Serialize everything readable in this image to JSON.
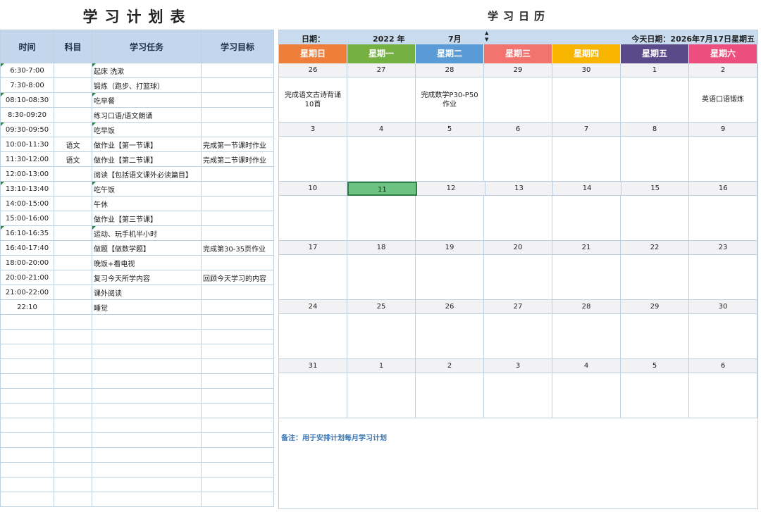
{
  "plan": {
    "title": "学习计划表",
    "headers": [
      "时间",
      "科目",
      "学习任务",
      "学习目标"
    ],
    "rows": [
      [
        "6:30-7:00",
        "",
        "起床 洗漱",
        ""
      ],
      [
        "7:30-8:00",
        "",
        "锻炼（跑步、打篮球）",
        ""
      ],
      [
        "08:10-08:30",
        "",
        "吃早餐",
        ""
      ],
      [
        "8:30-09:20",
        "",
        "练习口语/语文朗诵",
        ""
      ],
      [
        "09:30-09:50",
        "",
        "吃早饭",
        ""
      ],
      [
        "10:00-11:30",
        "语文",
        "做作业【第一节课】",
        "完成第一节课时作业"
      ],
      [
        "11:30-12:00",
        "语文",
        "做作业【第二节课】",
        "完成第二节课时作业"
      ],
      [
        "12:00-13:00",
        "",
        "阅读【包括语文课外必读篇目】",
        ""
      ],
      [
        "13:10-13:40",
        "",
        "吃午饭",
        ""
      ],
      [
        "14:00-15:00",
        "",
        "午休",
        ""
      ],
      [
        "15:00-16:00",
        "",
        "做作业【第三节课】",
        ""
      ],
      [
        "16:10-16:35",
        "",
        " 运动、玩手机半小时",
        ""
      ],
      [
        "16:40-17:40",
        "",
        "做题【做数学题】",
        "完成第30-35页作业"
      ],
      [
        "18:00-20:00",
        "",
        "晚饭+看电视",
        ""
      ],
      [
        "20:00-21:00",
        "",
        "复习今天所学内容",
        "回顾今天学习的内容"
      ],
      [
        "21:00-22:00",
        "",
        "课外阅读",
        ""
      ],
      [
        "22:10",
        "",
        "睡觉",
        ""
      ],
      [
        "",
        "",
        "",
        ""
      ],
      [
        "",
        "",
        "",
        ""
      ],
      [
        "",
        "",
        "",
        ""
      ],
      [
        "",
        "",
        "",
        ""
      ],
      [
        "",
        "",
        "",
        ""
      ],
      [
        "",
        "",
        "",
        ""
      ],
      [
        "",
        "",
        "",
        ""
      ],
      [
        "",
        "",
        "",
        ""
      ],
      [
        "",
        "",
        "",
        ""
      ],
      [
        "",
        "",
        "",
        ""
      ],
      [
        "",
        "",
        "",
        ""
      ],
      [
        "",
        "",
        "",
        ""
      ],
      [
        "",
        "",
        "",
        ""
      ]
    ],
    "marked_rows": [
      0,
      2,
      4,
      8,
      11
    ]
  },
  "calendar": {
    "title": "学习日历",
    "date_label": "日期：",
    "year": "2022 年",
    "month": "7月",
    "today_label": "今天日期：2026年7月17日星期五",
    "weekdays": [
      {
        "label": "星期日",
        "color": "#ee7f3a"
      },
      {
        "label": "星期一",
        "color": "#75b043"
      },
      {
        "label": "星期二",
        "color": "#5b9bd5"
      },
      {
        "label": "星期三",
        "color": "#f3736f"
      },
      {
        "label": "星期四",
        "color": "#f7b500"
      },
      {
        "label": "星期五",
        "color": "#5a4a8a"
      },
      {
        "label": "星期六",
        "color": "#ec4f7e"
      }
    ],
    "weeks": [
      {
        "days": [
          "26",
          "27",
          "28",
          "29",
          "30",
          "1",
          "2"
        ],
        "notes": [
          "完成语文古诗背诵10首",
          "",
          "完成数学P30-P50作业",
          "",
          "",
          "",
          "英语口语锻炼"
        ]
      },
      {
        "days": [
          "3",
          "4",
          "5",
          "6",
          "7",
          "8",
          "9"
        ],
        "notes": [
          "",
          "",
          "",
          "",
          "",
          "",
          ""
        ]
      },
      {
        "days": [
          "10",
          "11",
          "12",
          "13",
          "14",
          "15",
          "16"
        ],
        "notes": [
          "",
          "",
          "",
          "",
          "",
          "",
          ""
        ]
      },
      {
        "days": [
          "17",
          "18",
          "19",
          "20",
          "21",
          "22",
          "23"
        ],
        "notes": [
          "",
          "",
          "",
          "",
          "",
          "",
          ""
        ]
      },
      {
        "days": [
          "24",
          "25",
          "26",
          "27",
          "28",
          "29",
          "30"
        ],
        "notes": [
          "",
          "",
          "",
          "",
          "",
          "",
          ""
        ]
      },
      {
        "days": [
          "31",
          "1",
          "2",
          "3",
          "4",
          "5",
          "6"
        ],
        "notes": [
          "",
          "",
          "",
          "",
          "",
          "",
          ""
        ]
      }
    ],
    "selected_day": "11",
    "note": "备注：用于安排计划每月学习计划",
    "spin_up": "▲",
    "spin_down": "▼"
  }
}
